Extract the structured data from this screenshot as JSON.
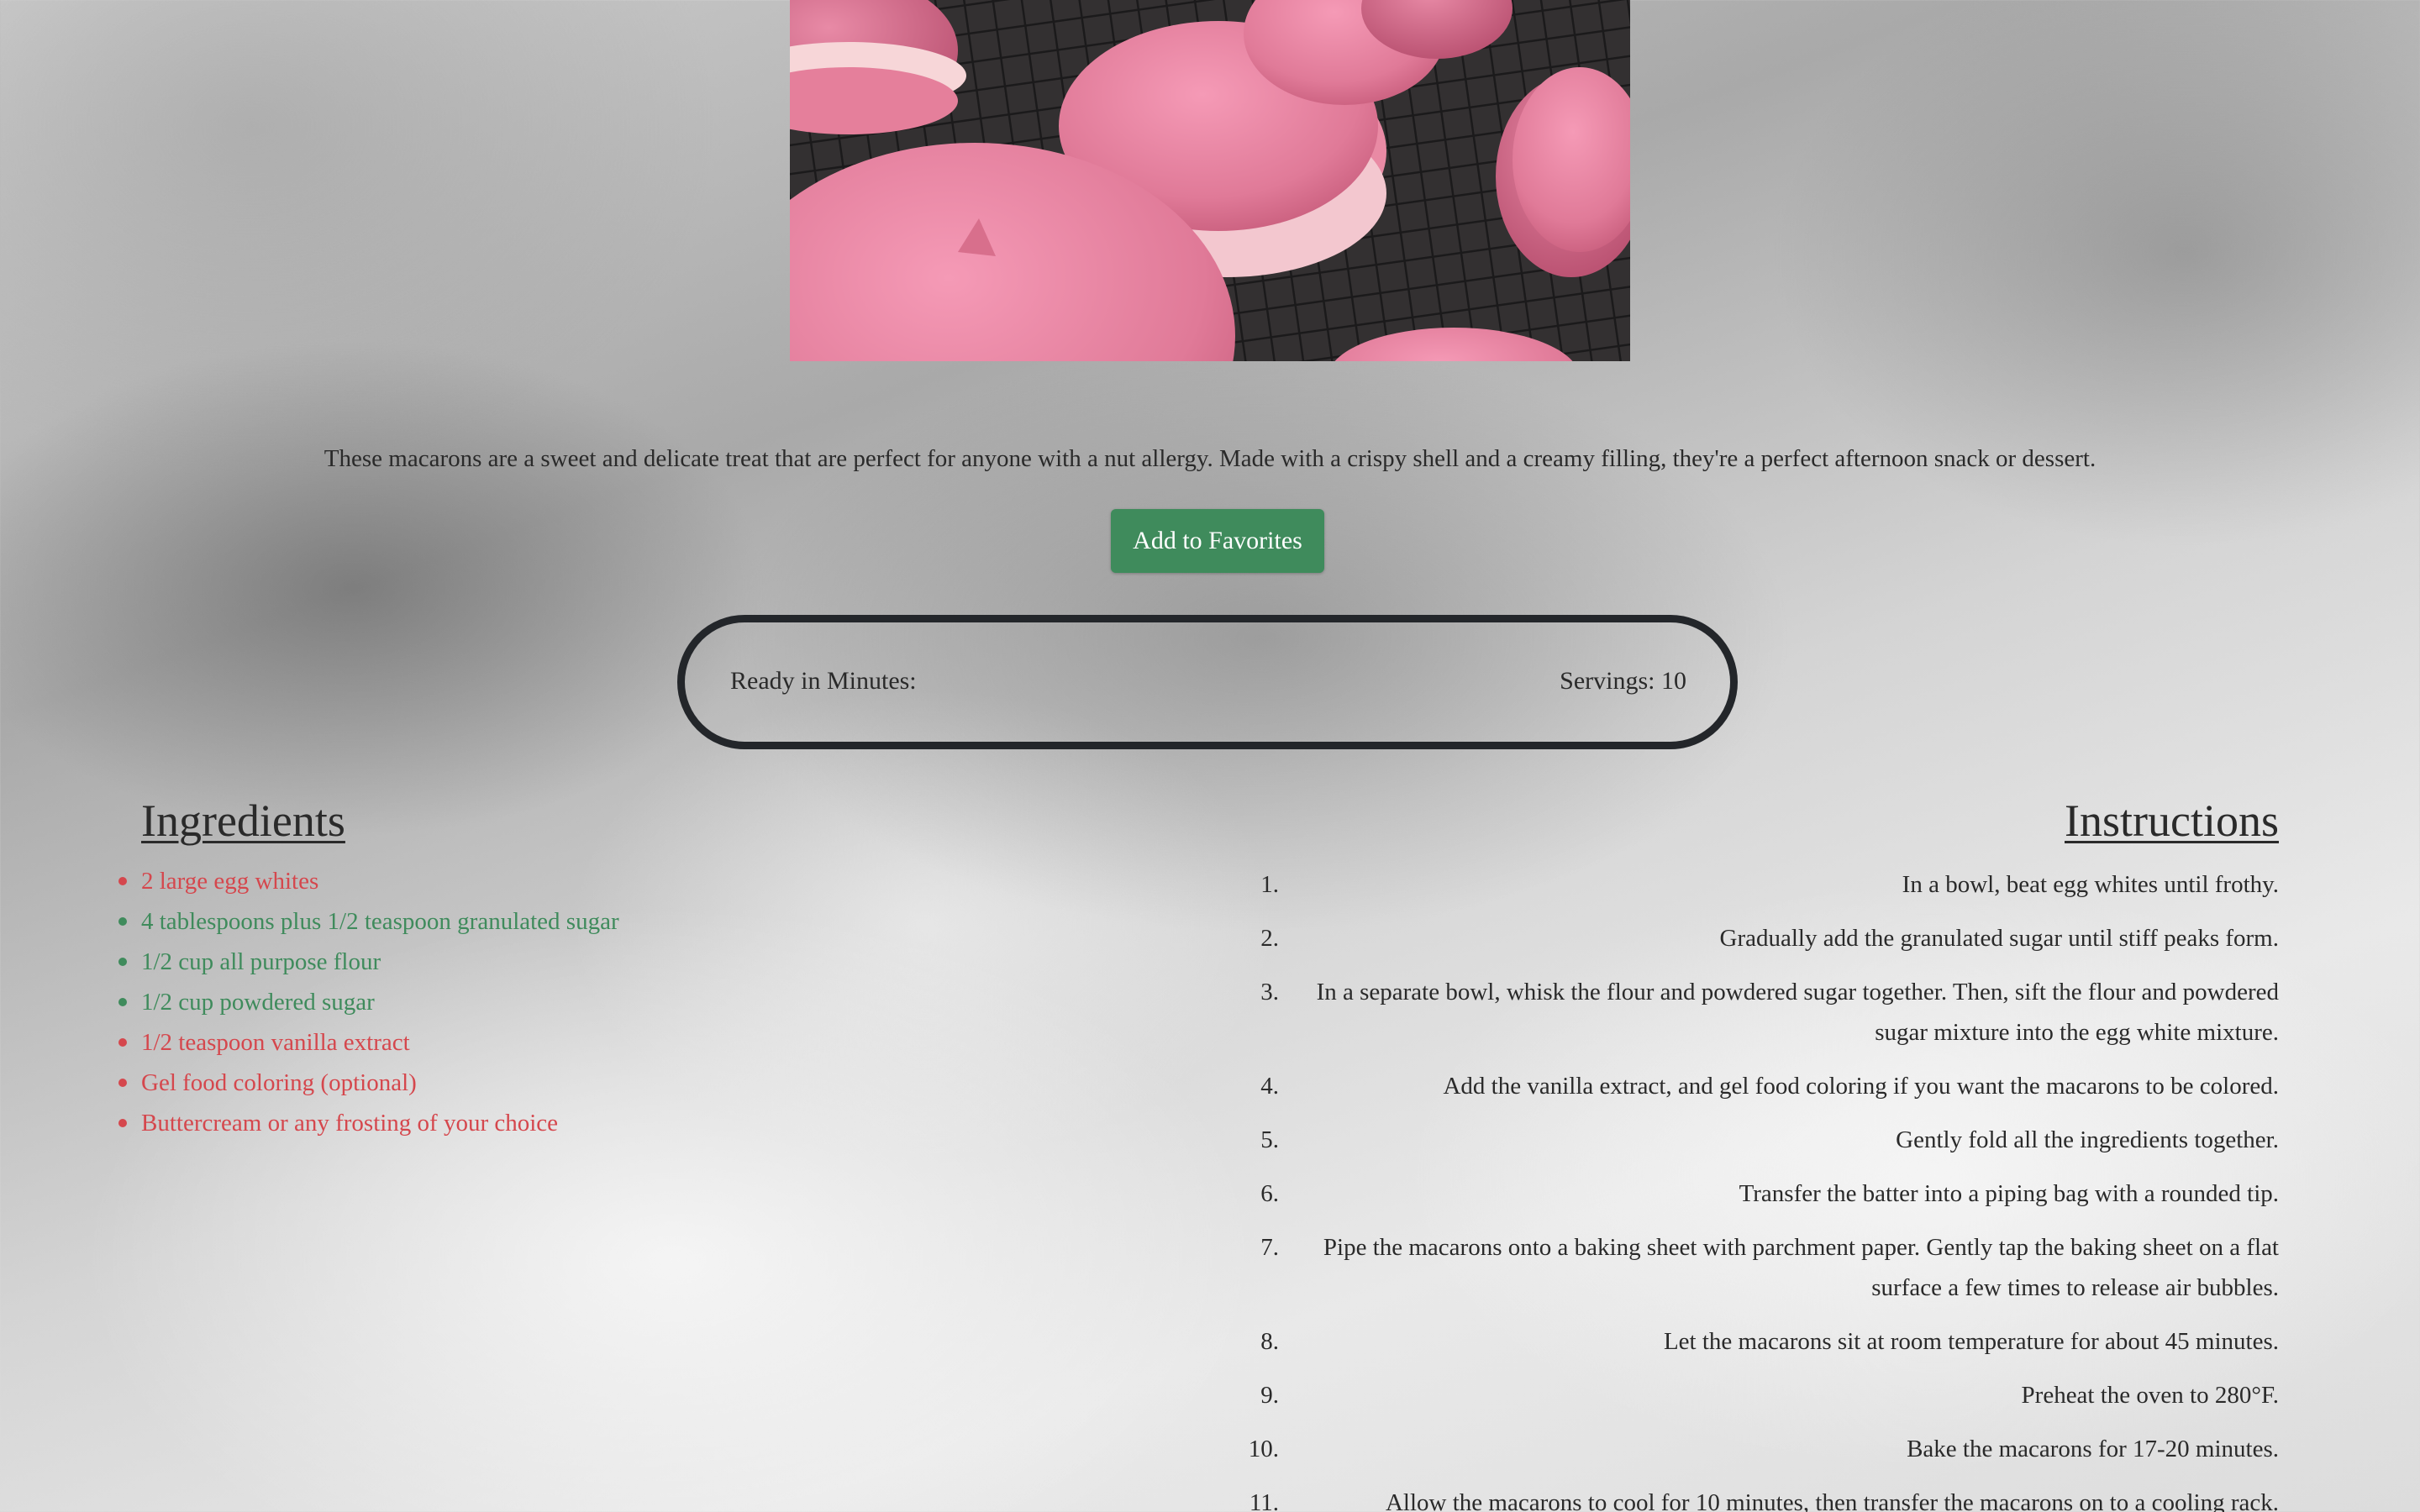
{
  "recipe": {
    "description": "These macarons are a sweet and delicate treat that are perfect for anyone with a nut allergy. Made with a crispy shell and a creamy filling, they're a perfect afternoon snack or dessert.",
    "favorite_button_label": "Add to Favorites",
    "ready_in_minutes_label": "Ready in Minutes:",
    "servings_label": "Servings: 10"
  },
  "ingredients": {
    "title": "Ingredients",
    "items": [
      {
        "text": "2 large egg whites",
        "color": "#d5474d"
      },
      {
        "text": "4 tablespoons plus 1/2 teaspoon granulated sugar",
        "color": "#3f8b5c"
      },
      {
        "text": "1/2 cup all purpose flour",
        "color": "#3f8b5c"
      },
      {
        "text": "1/2 cup powdered sugar",
        "color": "#3f8b5c"
      },
      {
        "text": "1/2 teaspoon vanilla extract",
        "color": "#d5474d"
      },
      {
        "text": "Gel food coloring (optional)",
        "color": "#d5474d"
      },
      {
        "text": "Buttercream or any frosting of your choice",
        "color": "#d5474d"
      }
    ]
  },
  "instructions": {
    "title": "Instructions",
    "steps": [
      {
        "num": "1.",
        "text": "In a bowl, beat egg whites until frothy."
      },
      {
        "num": "2.",
        "text": "Gradually add the granulated sugar until stiff peaks form."
      },
      {
        "num": "3.",
        "text": "In a separate bowl, whisk the flour and powdered sugar together. Then, sift the flour and powdered sugar mixture into the egg white mixture."
      },
      {
        "num": "4.",
        "text": "Add the vanilla extract, and gel food coloring if you want the macarons to be colored."
      },
      {
        "num": "5.",
        "text": "Gently fold all the ingredients together."
      },
      {
        "num": "6.",
        "text": "Transfer the batter into a piping bag with a rounded tip."
      },
      {
        "num": "7.",
        "text": "Pipe the macarons onto a baking sheet with parchment paper. Gently tap the baking sheet on a flat surface a few times to release air bubbles."
      },
      {
        "num": "8.",
        "text": "Let the macarons sit at room temperature for about 45 minutes."
      },
      {
        "num": "9.",
        "text": "Preheat the oven to 280°F."
      },
      {
        "num": "10.",
        "text": "Bake the macarons for 17-20 minutes."
      },
      {
        "num": "11.",
        "text": "Allow the macarons to cool for 10 minutes, then transfer the macarons on to a cooling rack."
      }
    ]
  },
  "colors": {
    "accent_green": "#3f8b5c",
    "accent_red": "#d5474d",
    "pill_border": "#23262a"
  }
}
